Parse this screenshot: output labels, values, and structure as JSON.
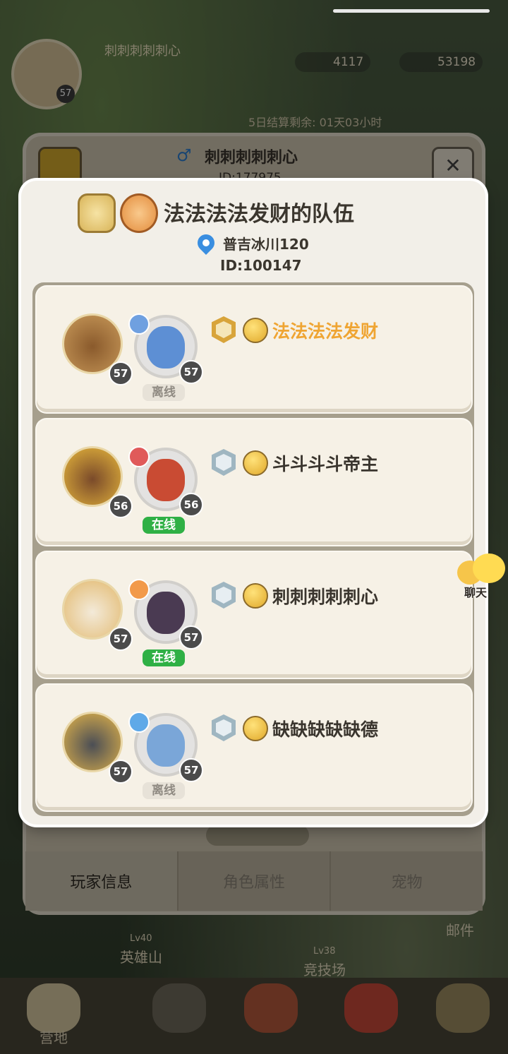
{
  "hud": {
    "player_name": "刺刺刺刺刺心",
    "level": "57",
    "resource1": "4117",
    "resource2": "53198",
    "timer": "5日结算剩余: 01天03小时"
  },
  "back_panel": {
    "title": "刺刺刺刺刺心",
    "id": "ID:177975",
    "tabs": [
      "玩家信息",
      "角色属性",
      "宠物"
    ],
    "close": "✕"
  },
  "map": {
    "hero_mountain": "英雄山",
    "hero_mountain_lv": "Lv40",
    "arena": "竞技场",
    "arena_lv": "Lv38",
    "mail": "邮件"
  },
  "bottom_nav": {
    "camp": "营地"
  },
  "team": {
    "name": "法法法法发财的队伍",
    "location": "普吉冰川120",
    "id": "ID:100147"
  },
  "members": [
    {
      "name": "法法法法发财",
      "pet_level": "57",
      "hero_level": "57",
      "status": "离线",
      "online": false,
      "leader": true
    },
    {
      "name": "斗斗斗斗帝主",
      "pet_level": "56",
      "hero_level": "56",
      "status": "在线",
      "online": true,
      "leader": false
    },
    {
      "name": "刺刺刺刺刺心",
      "pet_level": "57",
      "hero_level": "57",
      "status": "在线",
      "online": true,
      "leader": false
    },
    {
      "name": "缺缺缺缺缺德",
      "pet_level": "57",
      "hero_level": "57",
      "status": "离线",
      "online": false,
      "leader": false
    }
  ],
  "chat": {
    "label": "聊天"
  },
  "colors": {
    "leader_name": "#efa533",
    "online": "#2fb045",
    "location_pin": "#3a8ee0"
  }
}
